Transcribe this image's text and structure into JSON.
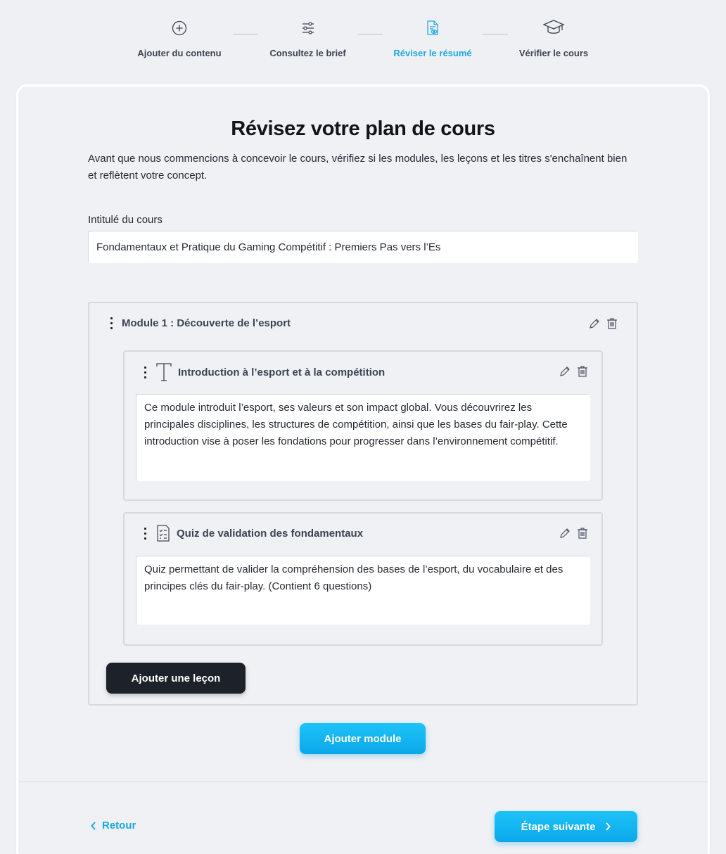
{
  "stepper": {
    "steps": [
      {
        "label": "Ajouter du contenu",
        "icon": "plus-circle-icon"
      },
      {
        "label": "Consultez le brief",
        "icon": "sliders-icon"
      },
      {
        "label": "Réviser le résumé",
        "icon": "document-review-icon"
      },
      {
        "label": "Vérifier le cours",
        "icon": "graduation-cap-icon"
      }
    ],
    "active_index": 2,
    "active_color": "#1ba8e0"
  },
  "page": {
    "title": "Révisez votre plan de cours",
    "description": "Avant que nous commencions à concevoir le cours, vérifiez si les modules, les leçons et les titres s'enchaînent bien et reflètent votre concept.",
    "course_title_label": "Intitulé du cours",
    "course_title_value": "Fondamentaux et Pratique du Gaming Compétitif : Premiers Pas vers l’Es"
  },
  "module": {
    "title": "Module 1 : Découverte de l’esport",
    "lessons": [
      {
        "title": "Introduction à l’esport et à la compétition",
        "icon": "text-icon",
        "body": "Ce module introduit l’esport, ses valeurs et son impact global. Vous découvrirez les principales disciplines, les structures de compétition, ainsi que les bases du fair-play. Cette introduction vise à poser les fondations pour progresser dans l’environnement compétitif."
      },
      {
        "title": "Quiz de validation des fondamentaux",
        "icon": "quiz-icon",
        "body": "Quiz permettant de valider la compréhension des bases de l’esport, du vocabulaire et des principes clés du fair-play. (Contient 6 questions)"
      }
    ],
    "add_lesson_label": "Ajouter une leçon"
  },
  "buttons": {
    "add_module": "Ajouter module",
    "back": "Retour",
    "next": "Étape suivante"
  },
  "colors": {
    "accent": "#1ba8e0",
    "dark_button": "#1c212a",
    "background": "#eef0f4"
  }
}
